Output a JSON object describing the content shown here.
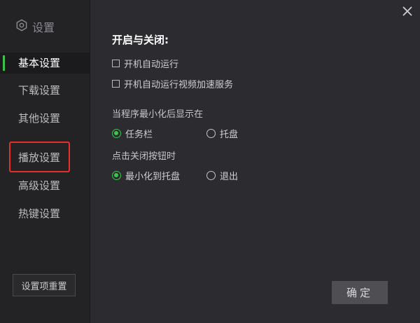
{
  "window": {
    "title": "设置"
  },
  "sidebar": {
    "items": [
      {
        "label": "基本设置",
        "active": true
      },
      {
        "label": "下载设置",
        "active": false
      },
      {
        "label": "其他设置",
        "active": false
      },
      {
        "label": "播放设置",
        "active": false
      },
      {
        "label": "高级设置",
        "active": false
      },
      {
        "label": "热键设置",
        "active": false
      }
    ],
    "reset_label": "设置项重置"
  },
  "main": {
    "section_title": "开启与关闭:",
    "checkboxes": [
      {
        "label": "开机自动运行",
        "checked": false
      },
      {
        "label": "开机自动运行视频加速服务",
        "checked": false
      }
    ],
    "minimize_group": {
      "label": "当程序最小化后显示在",
      "options": [
        {
          "label": "任务栏",
          "selected": true
        },
        {
          "label": "托盘",
          "selected": false
        }
      ]
    },
    "close_group": {
      "label": "点击关闭按钮时",
      "options": [
        {
          "label": "最小化到托盘",
          "selected": true
        },
        {
          "label": "退出",
          "selected": false
        }
      ]
    },
    "ok_label": "确定"
  },
  "colors": {
    "accent": "#3ec04e",
    "highlight": "#e0312a",
    "sidebar_bg": "#232326",
    "main_bg": "#2c2c30"
  },
  "icons": {
    "brand": "gear-hexagon-icon",
    "close": "close-icon"
  }
}
